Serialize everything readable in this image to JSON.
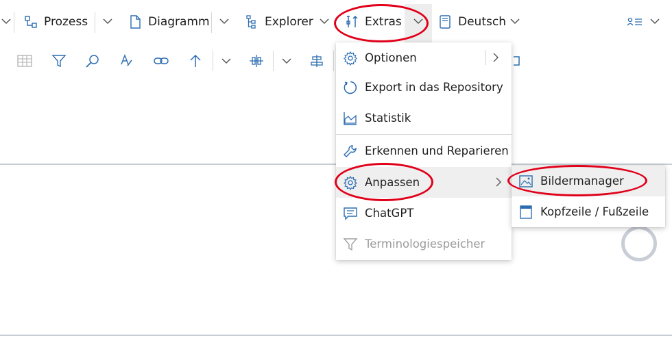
{
  "ribbon": {
    "prozess_label": "Prozess",
    "diagramm_label": "Diagramm",
    "explorer_label": "Explorer",
    "extras_label": "Extras",
    "language_label": "Deutsch"
  },
  "extras_menu": {
    "items": [
      {
        "label": "Optionen",
        "icon": "gear-icon"
      },
      {
        "label": "Export in das Repository",
        "icon": "refresh-icon"
      },
      {
        "label": "Statistik",
        "icon": "area-chart-icon"
      },
      {
        "label": "Erkennen und Reparieren",
        "icon": "wrench-icon"
      },
      {
        "label": "Anpassen",
        "icon": "gear-icon"
      },
      {
        "label": "ChatGPT",
        "icon": "chat-icon"
      },
      {
        "label": "Terminologiespeicher",
        "icon": "filter-icon"
      }
    ]
  },
  "anpassen_submenu": {
    "items": [
      {
        "label": "Bildermanager",
        "icon": "image-manager-icon"
      },
      {
        "label": "Kopfzeile / Fußzeile",
        "icon": "header-footer-icon"
      }
    ]
  },
  "colors": {
    "accent_blue": "#2b6cb0",
    "highlight_red": "#e0001a",
    "menu_hover": "#efefef"
  }
}
